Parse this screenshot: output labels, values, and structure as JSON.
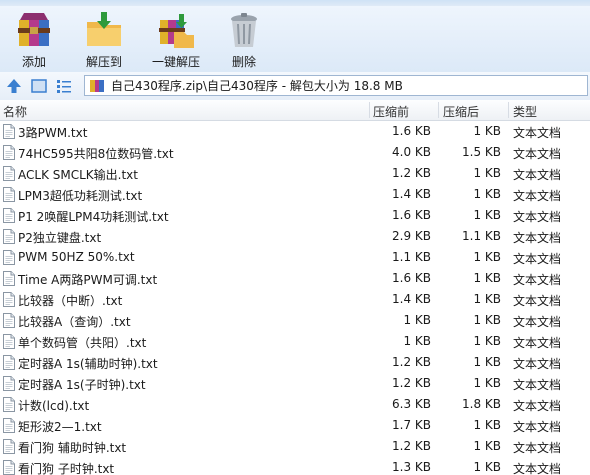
{
  "toolbar": {
    "buttons": [
      {
        "label": "添加",
        "icon": "add-archive-icon"
      },
      {
        "label": "解压到",
        "icon": "extract-to-icon"
      },
      {
        "label": "一键解压",
        "icon": "one-click-extract-icon"
      },
      {
        "label": "删除",
        "icon": "trash-can-icon"
      }
    ]
  },
  "address": {
    "path": "自己430程序.zip\\自己430程序 - 解包大小为 18.8 MB"
  },
  "columns": {
    "name": "名称",
    "compressed": "压缩前",
    "original": "压缩后",
    "type": "类型"
  },
  "files": [
    {
      "name": "3路PWM.txt",
      "compressed": "1.6 KB",
      "original": "1 KB",
      "type": "文本文档"
    },
    {
      "name": "74HC595共阳8位数码管.txt",
      "compressed": "4.0 KB",
      "original": "1.5 KB",
      "type": "文本文档"
    },
    {
      "name": "ACLK SMCLK输出.txt",
      "compressed": "1.2 KB",
      "original": "1 KB",
      "type": "文本文档"
    },
    {
      "name": "LPM3超低功耗测试.txt",
      "compressed": "1.4 KB",
      "original": "1 KB",
      "type": "文本文档"
    },
    {
      "name": "P1 2唤醒LPM4功耗测试.txt",
      "compressed": "1.6 KB",
      "original": "1 KB",
      "type": "文本文档"
    },
    {
      "name": "P2独立键盘.txt",
      "compressed": "2.9 KB",
      "original": "1.1 KB",
      "type": "文本文档"
    },
    {
      "name": "PWM 50HZ 50%.txt",
      "compressed": "1.1 KB",
      "original": "1 KB",
      "type": "文本文档"
    },
    {
      "name": "Time A两路PWM可调.txt",
      "compressed": "1.6 KB",
      "original": "1 KB",
      "type": "文本文档"
    },
    {
      "name": "比较器（中断）.txt",
      "compressed": "1.4 KB",
      "original": "1 KB",
      "type": "文本文档"
    },
    {
      "name": "比较器A（查询）.txt",
      "compressed": "1 KB",
      "original": "1 KB",
      "type": "文本文档"
    },
    {
      "name": "单个数码管（共阳）.txt",
      "compressed": "1 KB",
      "original": "1 KB",
      "type": "文本文档"
    },
    {
      "name": "定时器A 1s(辅助时钟).txt",
      "compressed": "1.2 KB",
      "original": "1 KB",
      "type": "文本文档"
    },
    {
      "name": "定时器A 1s(子时钟).txt",
      "compressed": "1.2 KB",
      "original": "1 KB",
      "type": "文本文档"
    },
    {
      "name": "计数(lcd).txt",
      "compressed": "6.3 KB",
      "original": "1.8 KB",
      "type": "文本文档"
    },
    {
      "name": "矩形波2—1.txt",
      "compressed": "1.7 KB",
      "original": "1 KB",
      "type": "文本文档"
    },
    {
      "name": "看门狗 辅助时钟.txt",
      "compressed": "1.2 KB",
      "original": "1 KB",
      "type": "文本文档"
    },
    {
      "name": "看门狗 子时钟.txt",
      "compressed": "1.3 KB",
      "original": "1 KB",
      "type": "文本文档"
    }
  ]
}
